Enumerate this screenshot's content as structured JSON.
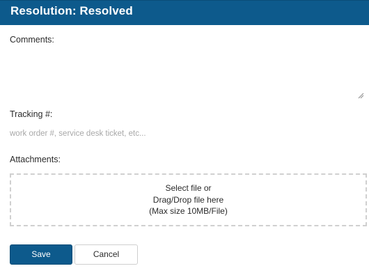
{
  "header": {
    "title": "Resolution: Resolved",
    "background_color": "#0d5a8c"
  },
  "form": {
    "comments": {
      "label": "Comments:",
      "value": ""
    },
    "tracking": {
      "label": "Tracking #:",
      "value": "",
      "placeholder": "work order #, service desk ticket, etc..."
    },
    "attachments": {
      "label": "Attachments:",
      "dropzone": {
        "line1": "Select file or",
        "line2": "Drag/Drop file here",
        "line3": "(Max size 10MB/File)"
      }
    }
  },
  "actions": {
    "save_label": "Save",
    "cancel_label": "Cancel",
    "primary_color": "#0d5a8c"
  },
  "icons": {
    "resize_grip": "resize-grip-icon"
  }
}
